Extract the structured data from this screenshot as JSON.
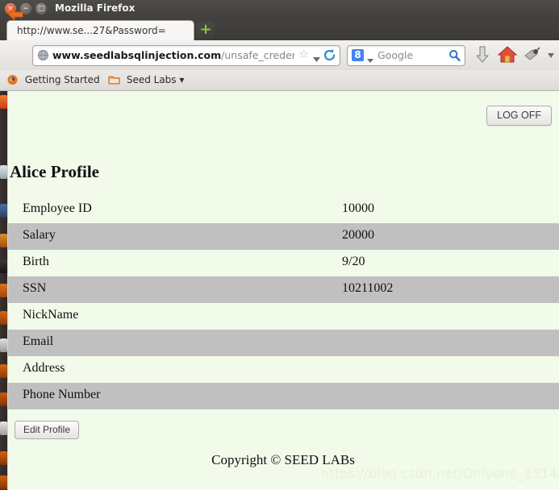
{
  "window": {
    "title": "Mozilla Firefox",
    "controls": {
      "close": "×",
      "minimize": "−",
      "maximize": "□"
    }
  },
  "tabs": {
    "active_label": "http://www.se...27&Password=",
    "new_tab_label": "+"
  },
  "toolbar": {
    "back_icon": "back-arrow-icon",
    "url": {
      "prefix": "www.",
      "domain": "seedlabsqlinjection.com",
      "path": "/unsafe_credenti",
      "full": "www.seedlabsqlinjection.com/unsafe_credenti",
      "star": "☆",
      "dropdown": "▾",
      "reload": "reload-icon",
      "site_icon": "globe-icon"
    },
    "search": {
      "engine": "Google",
      "engine_icon_letter": "8",
      "dropdown": "▾",
      "go_icon": "magnifier-icon"
    },
    "buttons": [
      {
        "name": "downloads-button",
        "icon": "download-arrow-icon"
      },
      {
        "name": "home-button",
        "icon": "home-icon"
      },
      {
        "name": "pocket-button",
        "icon": "pocket-icon"
      },
      {
        "name": "overflow-button",
        "icon": "chevron-down-icon"
      }
    ]
  },
  "bookmarks": {
    "items": [
      {
        "label": "Getting Started",
        "icon": "firefox-icon"
      },
      {
        "label": "Seed Labs ▾",
        "icon": "folder-icon"
      }
    ]
  },
  "page": {
    "logoff_label": "LOG OFF",
    "title": "Alice Profile",
    "table": {
      "rows": [
        {
          "label": "Employee ID",
          "value": "10000"
        },
        {
          "label": "Salary",
          "value": "20000"
        },
        {
          "label": "Birth",
          "value": "9/20"
        },
        {
          "label": "SSN",
          "value": "10211002"
        },
        {
          "label": "NickName",
          "value": ""
        },
        {
          "label": "Email",
          "value": ""
        },
        {
          "label": "Address",
          "value": ""
        },
        {
          "label": "Phone Number",
          "value": ""
        }
      ]
    },
    "edit_profile_label": "Edit Profile",
    "copyright": "Copyright © SEED LABs",
    "watermark": "https://blog.csdn.net/Onlyone_1314"
  },
  "colors": {
    "page_background": "#f2faea",
    "row_alt_background": "#c0c0c0",
    "titlebar": "#46443f",
    "accent_close": "#dd4814",
    "google_blue": "#4285f4"
  }
}
